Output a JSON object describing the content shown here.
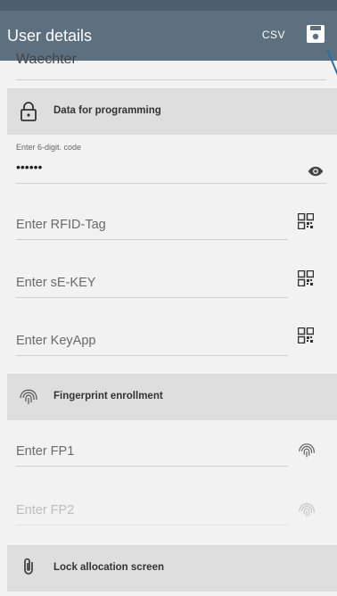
{
  "app_bar": {
    "title": "User details",
    "csv_label": "CSV",
    "save_icon": "save-icon"
  },
  "previous_field": {
    "value": "Waechter"
  },
  "sections": {
    "programming": {
      "label": "Data for programming",
      "icon": "lock-icon"
    },
    "fingerprint": {
      "label": "Fingerprint enrollment",
      "icon": "fingerprint-icon"
    },
    "lock_allocation": {
      "label": "Lock allocation screen",
      "icon": "paperclip-icon"
    }
  },
  "fields": {
    "code": {
      "label": "Enter 6-digit. code",
      "value": "••••••",
      "icon": "eye-icon"
    },
    "rfid": {
      "placeholder": "Enter RFID-Tag",
      "icon": "qr-code-icon"
    },
    "sekey": {
      "placeholder": "Enter sE-KEY",
      "icon": "qr-code-icon"
    },
    "keyapp": {
      "placeholder": "Enter KeyApp",
      "icon": "qr-code-icon"
    },
    "fp1": {
      "placeholder": "Enter FP1",
      "icon": "fingerprint-icon"
    },
    "fp2": {
      "placeholder": "Enter FP2",
      "icon": "fingerprint-icon"
    }
  },
  "colors": {
    "app_bar": "#5c7080",
    "section_bg": "#dedede",
    "page_bg": "#f2f2f2",
    "pointer": "#2c6ea8"
  }
}
